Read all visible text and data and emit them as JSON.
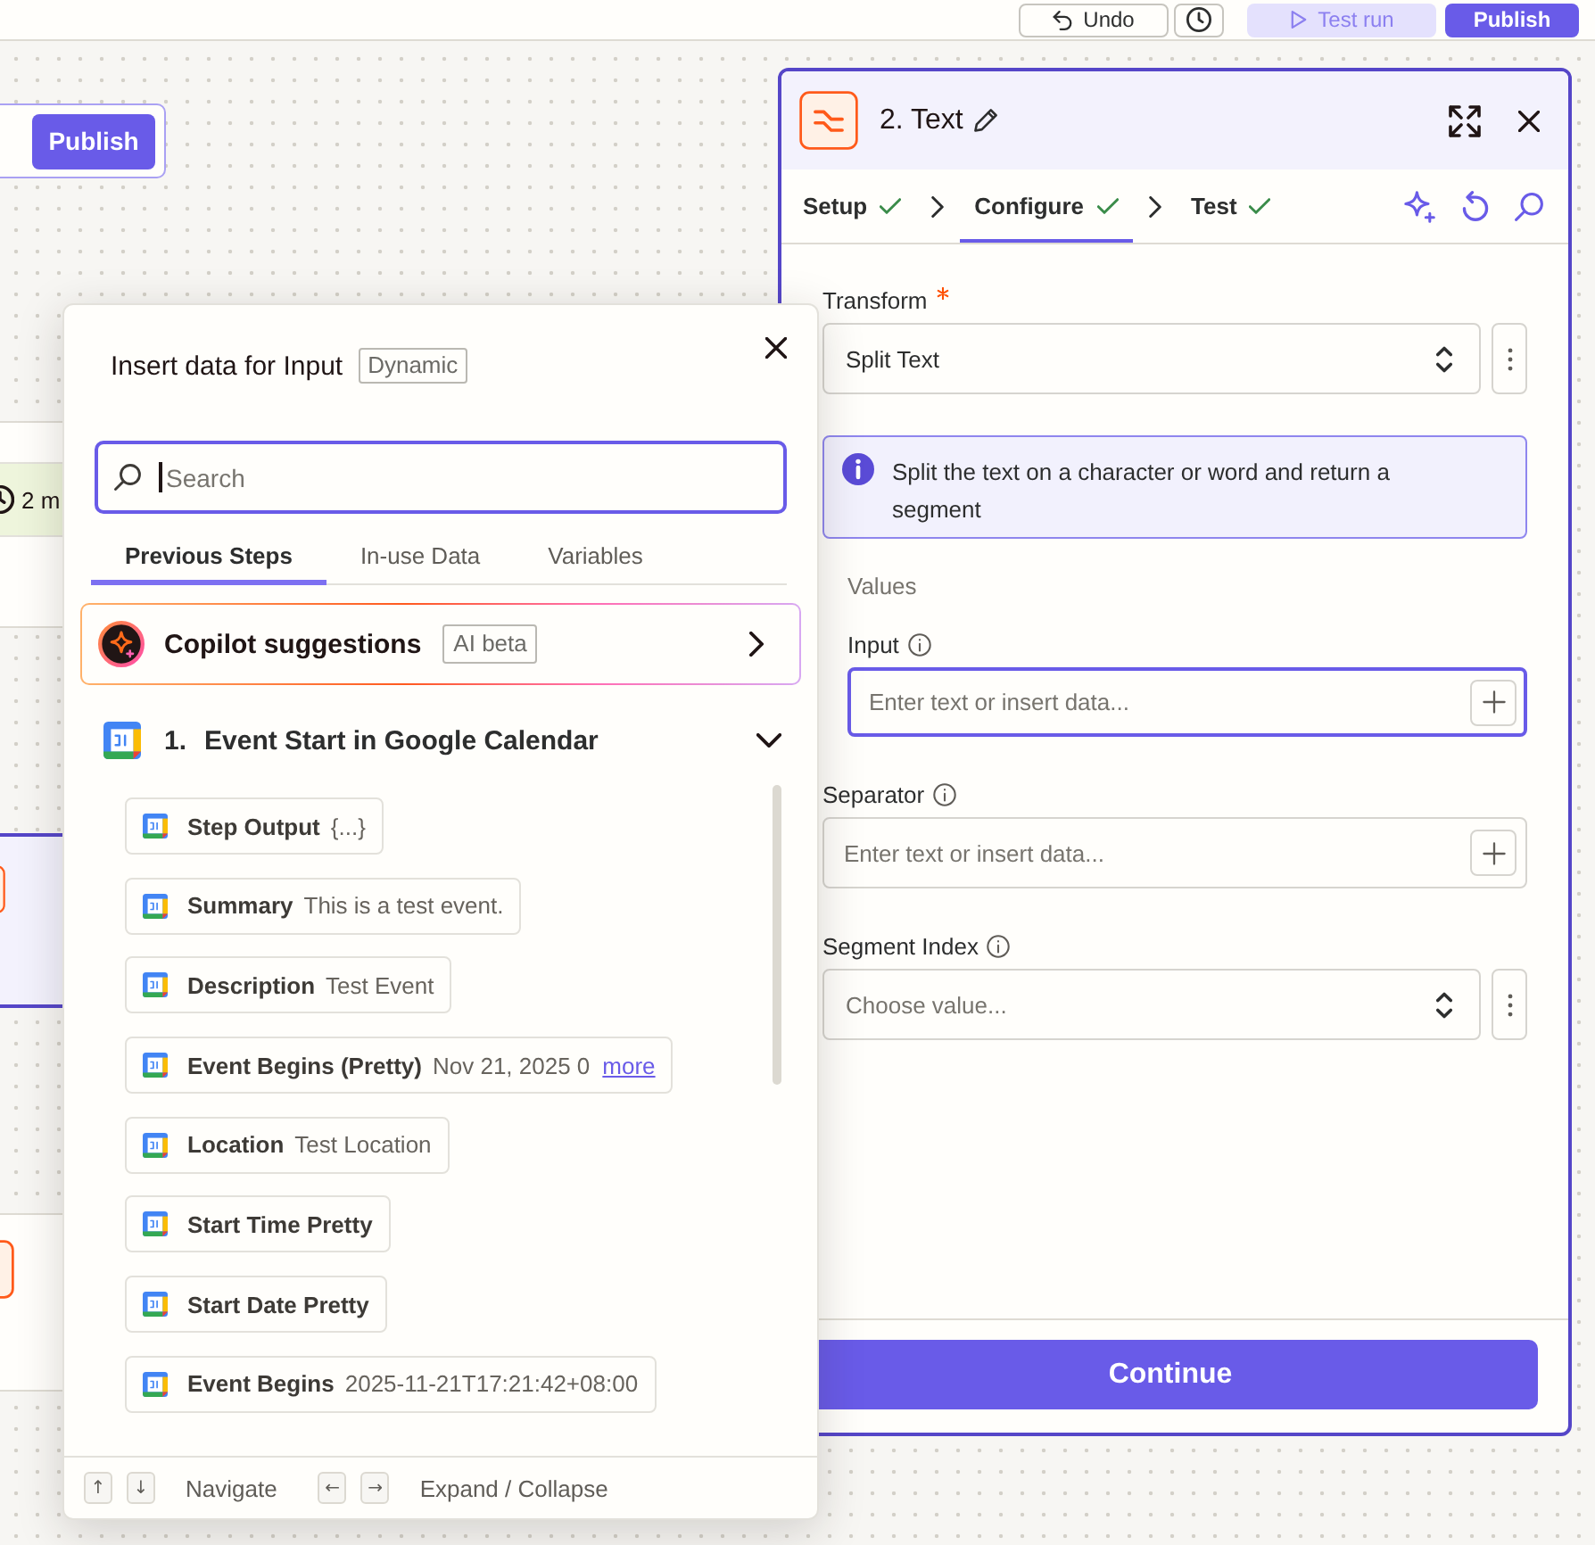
{
  "topbar": {
    "buttons": [
      {
        "kind": "undo",
        "label": "Undo"
      },
      {
        "kind": "history"
      },
      {
        "kind": "test",
        "label": "Test run"
      },
      {
        "kind": "publish",
        "label": "Publish"
      }
    ]
  },
  "canvas": {
    "nodes": [
      {
        "kind": "publish",
        "button": "Publish"
      },
      {
        "kind": "duration",
        "text": "2 m"
      },
      {
        "kind": "step",
        "selected": true
      },
      {
        "kind": "step",
        "selected": false
      }
    ]
  },
  "panel": {
    "title": "2. Text",
    "tabs": [
      {
        "label": "Setup",
        "done": true,
        "selected": false
      },
      {
        "label": "Configure",
        "done": true,
        "selected": true
      },
      {
        "label": "Test",
        "done": true,
        "selected": false
      }
    ],
    "fields": [
      {
        "kind": "select",
        "label": "Transform",
        "required": true,
        "info": false,
        "value": "Split Text"
      },
      {
        "kind": "info",
        "text": "Split the text on a character or word and return a segment"
      },
      {
        "kind": "group",
        "label": "Values",
        "children": [
          {
            "kind": "text",
            "label": "Input",
            "required": false,
            "info": true,
            "placeholder": "Enter text or insert data...",
            "focused": true
          }
        ]
      },
      {
        "kind": "text",
        "label": "Separator",
        "required": false,
        "info": true,
        "placeholder": "Enter text or insert data...",
        "focused": false
      },
      {
        "kind": "select",
        "label": "Segment Index",
        "required": false,
        "info": true,
        "placeholder": "Choose value..."
      }
    ],
    "continue": "Continue"
  },
  "popup": {
    "title": "Insert data for Input",
    "tag": "Dynamic",
    "search": {
      "placeholder": "Search",
      "focused": true
    },
    "tabs": [
      {
        "label": "Previous Steps",
        "selected": true
      },
      {
        "label": "In-use Data",
        "selected": false
      },
      {
        "label": "Variables",
        "selected": false
      }
    ],
    "copilot": {
      "title": "Copilot suggestions",
      "tag": "AI beta"
    },
    "step": {
      "number": "1.",
      "title": "Event Start in Google Calendar",
      "expanded": true,
      "items": [
        {
          "label": "Step Output",
          "value": "{...}"
        },
        {
          "label": "Summary",
          "value": "This is a test event."
        },
        {
          "label": "Description",
          "value": "Test Event"
        },
        {
          "label": "Event Begins (Pretty)",
          "value": "Nov 21, 2025 0",
          "more": "more"
        },
        {
          "label": "Location",
          "value": "Test Location"
        },
        {
          "label": "Start Time Pretty"
        },
        {
          "label": "Start Date Pretty"
        },
        {
          "label": "Event Begins",
          "value": "2025-11-21T17:21:42+08:00"
        }
      ]
    },
    "hints": [
      {
        "keys": [
          "↑",
          "↓"
        ],
        "label": "Navigate"
      },
      {
        "keys": [
          "←",
          "→"
        ],
        "label": "Expand / Collapse"
      }
    ]
  }
}
